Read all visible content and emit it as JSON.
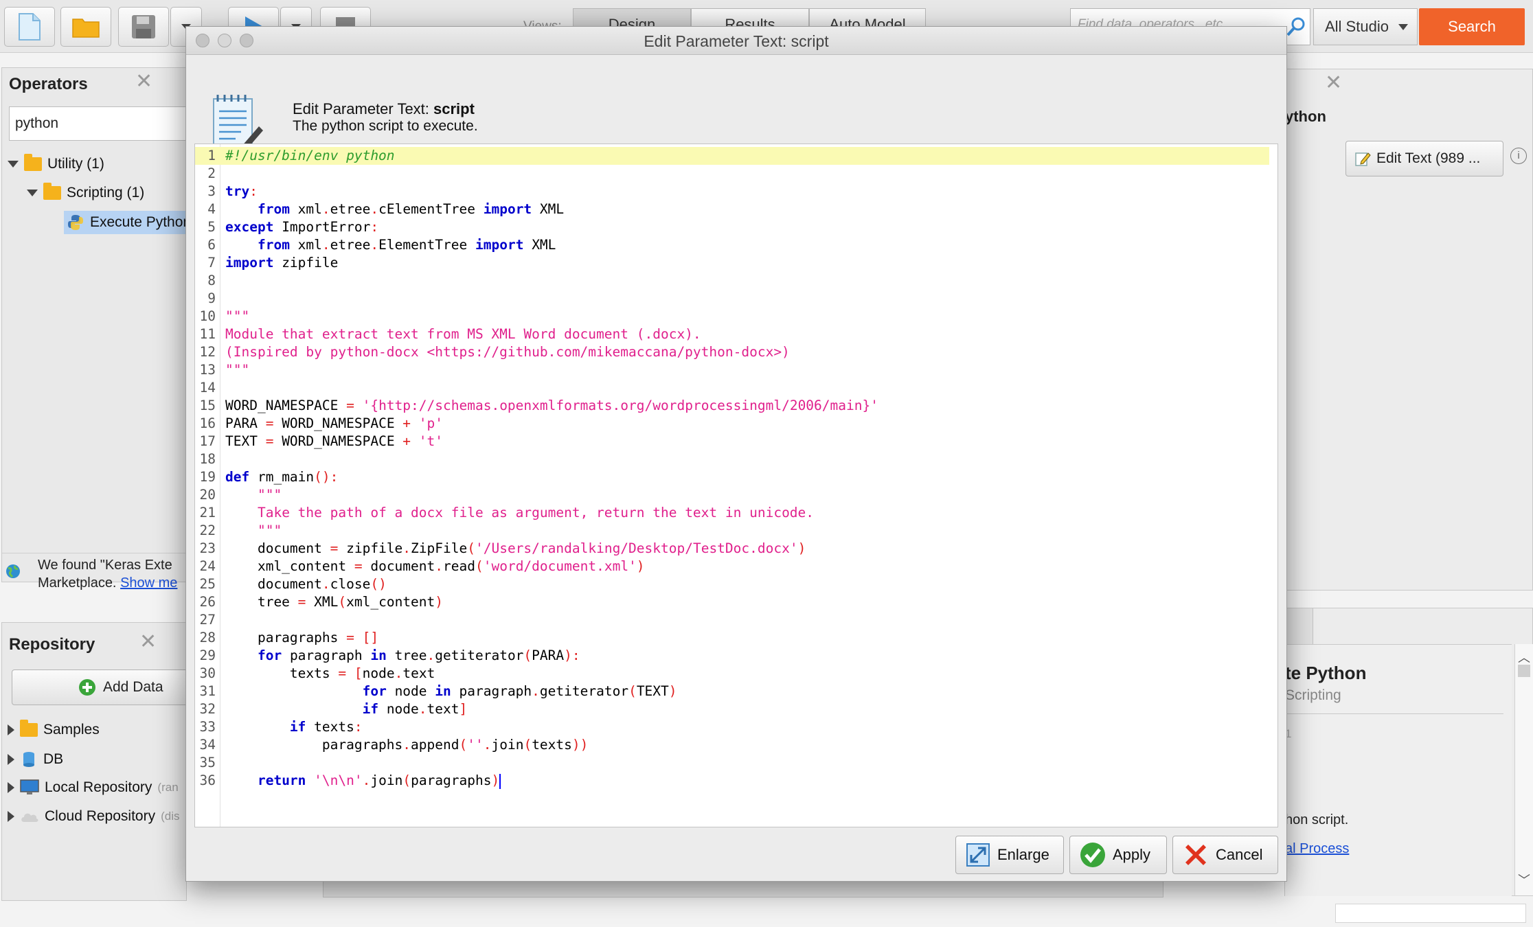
{
  "toolbar": {
    "views_label": "Views:",
    "view_tabs": [
      "Design",
      "Results",
      "Auto Model"
    ],
    "search_placeholder": "Find data, operators...etc",
    "studio_select": "All Studio",
    "search_button": "Search"
  },
  "operators_panel": {
    "title": "Operators",
    "filter_value": "python",
    "tree": [
      {
        "label": "Utility (1)"
      },
      {
        "label": "Scripting (1)"
      },
      {
        "label": "Execute Python"
      }
    ],
    "notice_line1": "We found \"Keras Exte",
    "notice_line2": "Marketplace.",
    "notice_link": "Show me"
  },
  "repository_panel": {
    "title": "Repository",
    "add_data": "Add Data",
    "items": [
      {
        "label": "Samples",
        "suffix": ""
      },
      {
        "label": "DB",
        "suffix": ""
      },
      {
        "label": "Local Repository",
        "suffix": "(ran"
      },
      {
        "label": "Cloud Repository",
        "suffix": "(dis"
      }
    ]
  },
  "right_panel": {
    "heading": "ython",
    "edit_text_button": "Edit Text (989 ...",
    "help_title": "te Python",
    "help_sub": "Scripting",
    "help_mark": "1",
    "help_desc": "hon script.",
    "help_link": "al Process"
  },
  "dialog": {
    "title": "Edit Parameter Text: script",
    "header_prefix": "Edit Parameter Text: ",
    "header_param": "script",
    "header_desc": "The python script to execute.",
    "buttons": {
      "enlarge": "Enlarge",
      "apply": "Apply",
      "cancel": "Cancel"
    }
  },
  "colors": {
    "keyword": "#0000cc",
    "string": "#e0208c",
    "comment": "#2d9c2d",
    "operator": "#e02020",
    "highlight_line": "#fafab3",
    "search_button": "#f0632a"
  },
  "code": [
    [
      [
        "c",
        "#!/usr/bin/env python"
      ]
    ],
    [],
    [
      [
        "k",
        "try"
      ],
      [
        "o",
        ":"
      ]
    ],
    [
      [
        "t",
        "    "
      ],
      [
        "k",
        "from"
      ],
      [
        "t",
        " xml"
      ],
      [
        "o",
        "."
      ],
      [
        "t",
        "etree"
      ],
      [
        "o",
        "."
      ],
      [
        "t",
        "cElementTree "
      ],
      [
        "k",
        "import"
      ],
      [
        "t",
        " XML"
      ]
    ],
    [
      [
        "k",
        "except"
      ],
      [
        "t",
        " ImportError"
      ],
      [
        "o",
        ":"
      ]
    ],
    [
      [
        "t",
        "    "
      ],
      [
        "k",
        "from"
      ],
      [
        "t",
        " xml"
      ],
      [
        "o",
        "."
      ],
      [
        "t",
        "etree"
      ],
      [
        "o",
        "."
      ],
      [
        "t",
        "ElementTree "
      ],
      [
        "k",
        "import"
      ],
      [
        "t",
        " XML"
      ]
    ],
    [
      [
        "k",
        "import"
      ],
      [
        "t",
        " zipfile"
      ]
    ],
    [],
    [],
    [
      [
        "s",
        "\"\"\""
      ]
    ],
    [
      [
        "s",
        "Module that extract text from MS XML Word document (.docx)."
      ]
    ],
    [
      [
        "s",
        "(Inspired by python-docx <https://github.com/mikemaccana/python-docx>)"
      ]
    ],
    [
      [
        "s",
        "\"\"\""
      ]
    ],
    [],
    [
      [
        "t",
        "WORD_NAMESPACE "
      ],
      [
        "o",
        "="
      ],
      [
        "t",
        " "
      ],
      [
        "s",
        "'{http://schemas.openxmlformats.org/wordprocessingml/2006/main}'"
      ]
    ],
    [
      [
        "t",
        "PARA "
      ],
      [
        "o",
        "="
      ],
      [
        "t",
        " WORD_NAMESPACE "
      ],
      [
        "o",
        "+"
      ],
      [
        "t",
        " "
      ],
      [
        "s",
        "'p'"
      ]
    ],
    [
      [
        "t",
        "TEXT "
      ],
      [
        "o",
        "="
      ],
      [
        "t",
        " WORD_NAMESPACE "
      ],
      [
        "o",
        "+"
      ],
      [
        "t",
        " "
      ],
      [
        "s",
        "'t'"
      ]
    ],
    [],
    [
      [
        "k",
        "def"
      ],
      [
        "t",
        " rm_main"
      ],
      [
        "o",
        "():"
      ]
    ],
    [
      [
        "t",
        "    "
      ],
      [
        "s",
        "\"\"\""
      ]
    ],
    [
      [
        "t",
        "    "
      ],
      [
        "s",
        "Take the path of a docx file as argument, return the text in unicode."
      ]
    ],
    [
      [
        "t",
        "    "
      ],
      [
        "s",
        "\"\"\""
      ]
    ],
    [
      [
        "t",
        "    document "
      ],
      [
        "o",
        "="
      ],
      [
        "t",
        " zipfile"
      ],
      [
        "o",
        "."
      ],
      [
        "t",
        "ZipFile"
      ],
      [
        "o",
        "("
      ],
      [
        "s",
        "'/Users/randalking/Desktop/TestDoc.docx'"
      ],
      [
        "o",
        ")"
      ]
    ],
    [
      [
        "t",
        "    xml_content "
      ],
      [
        "o",
        "="
      ],
      [
        "t",
        " document"
      ],
      [
        "o",
        "."
      ],
      [
        "t",
        "read"
      ],
      [
        "o",
        "("
      ],
      [
        "s",
        "'word/document.xml'"
      ],
      [
        "o",
        ")"
      ]
    ],
    [
      [
        "t",
        "    document"
      ],
      [
        "o",
        "."
      ],
      [
        "t",
        "close"
      ],
      [
        "o",
        "()"
      ]
    ],
    [
      [
        "t",
        "    tree "
      ],
      [
        "o",
        "="
      ],
      [
        "t",
        " XML"
      ],
      [
        "o",
        "("
      ],
      [
        "t",
        "xml_content"
      ],
      [
        "o",
        ")"
      ]
    ],
    [],
    [
      [
        "t",
        "    paragraphs "
      ],
      [
        "o",
        "="
      ],
      [
        "t",
        " "
      ],
      [
        "o",
        "[]"
      ]
    ],
    [
      [
        "t",
        "    "
      ],
      [
        "k",
        "for"
      ],
      [
        "t",
        " paragraph "
      ],
      [
        "k",
        "in"
      ],
      [
        "t",
        " tree"
      ],
      [
        "o",
        "."
      ],
      [
        "t",
        "getiterator"
      ],
      [
        "o",
        "("
      ],
      [
        "t",
        "PARA"
      ],
      [
        "o",
        "):"
      ]
    ],
    [
      [
        "t",
        "        texts "
      ],
      [
        "o",
        "="
      ],
      [
        "t",
        " "
      ],
      [
        "o",
        "["
      ],
      [
        "t",
        "node"
      ],
      [
        "o",
        "."
      ],
      [
        "t",
        "text"
      ]
    ],
    [
      [
        "t",
        "                 "
      ],
      [
        "k",
        "for"
      ],
      [
        "t",
        " node "
      ],
      [
        "k",
        "in"
      ],
      [
        "t",
        " paragraph"
      ],
      [
        "o",
        "."
      ],
      [
        "t",
        "getiterator"
      ],
      [
        "o",
        "("
      ],
      [
        "t",
        "TEXT"
      ],
      [
        "o",
        ")"
      ]
    ],
    [
      [
        "t",
        "                 "
      ],
      [
        "k",
        "if"
      ],
      [
        "t",
        " node"
      ],
      [
        "o",
        "."
      ],
      [
        "t",
        "text"
      ],
      [
        "o",
        "]"
      ]
    ],
    [
      [
        "t",
        "        "
      ],
      [
        "k",
        "if"
      ],
      [
        "t",
        " texts"
      ],
      [
        "o",
        ":"
      ]
    ],
    [
      [
        "t",
        "            paragraphs"
      ],
      [
        "o",
        "."
      ],
      [
        "t",
        "append"
      ],
      [
        "o",
        "("
      ],
      [
        "s",
        "''"
      ],
      [
        "o",
        "."
      ],
      [
        "t",
        "join"
      ],
      [
        "o",
        "("
      ],
      [
        "t",
        "texts"
      ],
      [
        "o",
        "))"
      ]
    ],
    [],
    [
      [
        "t",
        "    "
      ],
      [
        "k",
        "return"
      ],
      [
        "t",
        " "
      ],
      [
        "s",
        "'\\n\\n'"
      ],
      [
        "o",
        "."
      ],
      [
        "t",
        "join"
      ],
      [
        "o",
        "("
      ],
      [
        "t",
        "paragraphs"
      ],
      [
        "o",
        ")"
      ]
    ]
  ]
}
